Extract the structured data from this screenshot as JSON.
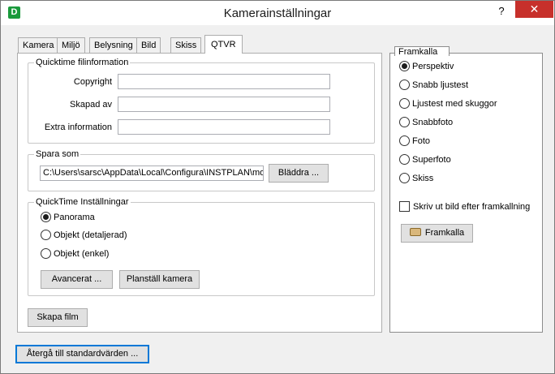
{
  "window": {
    "title": "Kamerainställningar",
    "help_label": "?",
    "close_label": "✕",
    "app_icon_glyph": "D"
  },
  "tabs": [
    {
      "label": "Kamera",
      "active": false
    },
    {
      "label": "Miljö",
      "active": false
    },
    {
      "label": "Belysning",
      "active": false
    },
    {
      "label": "Bild",
      "active": false
    },
    {
      "label": "Skiss",
      "active": false
    },
    {
      "label": "QTVR",
      "active": true
    }
  ],
  "qt_info": {
    "legend": "Quicktime filinformation",
    "copyright_label": "Copyright",
    "copyright_value": "",
    "created_label": "Skapad av",
    "created_value": "",
    "extra_label": "Extra information",
    "extra_value": ""
  },
  "save_as": {
    "legend": "Spara som",
    "path_value": "C:\\Users\\sarsc\\AppData\\Local\\Configura\\INSTPLAN\\mo",
    "browse_label": "Bläddra ..."
  },
  "qt_settings": {
    "legend": "QuickTime Inställningar",
    "options": [
      {
        "label": "Panorama",
        "checked": true
      },
      {
        "label": "Objekt (detaljerad)",
        "checked": false
      },
      {
        "label": "Objekt (enkel)",
        "checked": false
      }
    ],
    "advanced_label": "Avancerat ...",
    "level_camera_label": "Planställ kamera"
  },
  "create_movie_label": "Skapa film",
  "reset_label": "Återgå till standardvärden ...",
  "render": {
    "legend": "Framkalla",
    "options": [
      {
        "label": "Perspektiv",
        "checked": true
      },
      {
        "label": "Snabb ljustest",
        "checked": false
      },
      {
        "label": "Ljustest med skuggor",
        "checked": false
      },
      {
        "label": "Snabbfoto",
        "checked": false
      },
      {
        "label": "Foto",
        "checked": false
      },
      {
        "label": "Superfoto",
        "checked": false
      },
      {
        "label": "Skiss",
        "checked": false
      }
    ],
    "print_after_label": "Skriv ut bild efter framkallning",
    "print_after_checked": false,
    "render_button_label": "Framkalla",
    "render_button_icon": "camera-icon"
  },
  "colors": {
    "accent": "#0078d7",
    "close_bg": "#c7302b",
    "app_icon": "#1a9a3c"
  }
}
